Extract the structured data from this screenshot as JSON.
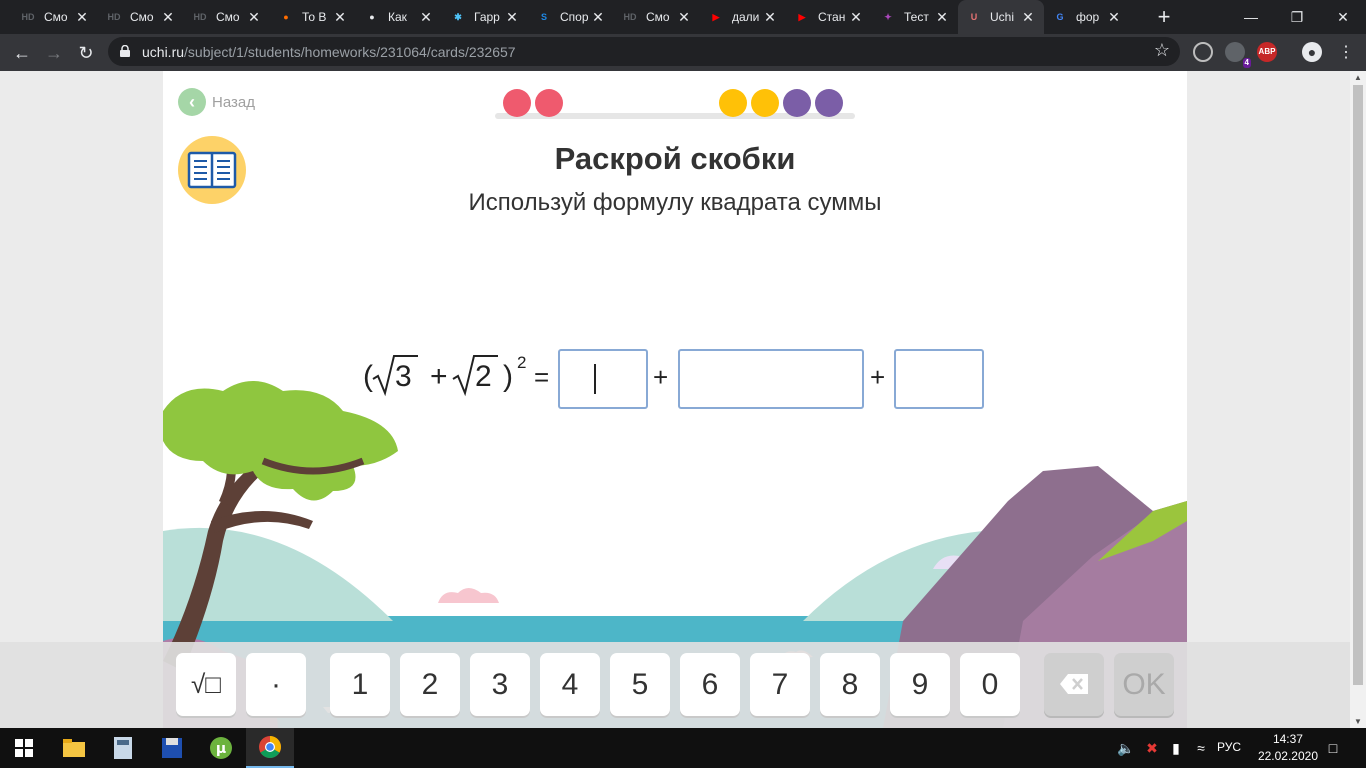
{
  "browser": {
    "tabs": [
      {
        "title": "Смо",
        "icon": "hd-icon",
        "icon_text": "HD",
        "icon_color": "#5f6368"
      },
      {
        "title": "Смо",
        "icon": "hd-icon",
        "icon_text": "HD",
        "icon_color": "#5f6368"
      },
      {
        "title": "Смо",
        "icon": "hd-icon",
        "icon_text": "HD",
        "icon_color": "#5f6368"
      },
      {
        "title": "То В",
        "icon": "flame-icon",
        "icon_text": "●",
        "icon_color": "#ff6d00"
      },
      {
        "title": "Как",
        "icon": "globe-icon",
        "icon_text": "●",
        "icon_color": "#e8eaed"
      },
      {
        "title": "Гарр",
        "icon": "sparkle-icon",
        "icon_text": "✱",
        "icon_color": "#4fc3f7"
      },
      {
        "title": "Спор",
        "icon": "s-icon",
        "icon_text": "S",
        "icon_color": "#1e88e5"
      },
      {
        "title": "Смо",
        "icon": "hd-icon",
        "icon_text": "HD",
        "icon_color": "#5f6368"
      },
      {
        "title": "дали",
        "icon": "youtube-icon",
        "icon_text": "▶",
        "icon_color": "#ff0000"
      },
      {
        "title": "Стан",
        "icon": "youtube-icon",
        "icon_text": "▶",
        "icon_color": "#ff0000"
      },
      {
        "title": "Тест",
        "icon": "wand-icon",
        "icon_text": "✦",
        "icon_color": "#ab47bc"
      },
      {
        "title": "Uchi",
        "icon": "uchi-icon",
        "icon_text": "U",
        "icon_color": "#e57373",
        "active": true
      },
      {
        "title": "фор",
        "icon": "google-icon",
        "icon_text": "G",
        "icon_color": "#4285f4"
      }
    ],
    "url_host": "uchi.ru",
    "url_path": "/subject/1/students/homeworks/231064/cards/232657",
    "extension_badge": "4",
    "adblock_label": "ABP"
  },
  "page": {
    "back_label": "Назад",
    "progress": [
      {
        "color": "#ef5a6e",
        "state": "wrong"
      },
      {
        "color": "#ef5a6e",
        "state": "wrong"
      },
      {
        "color": "#ffc107",
        "state": "correct"
      },
      {
        "color": "#ffc107",
        "state": "correct"
      },
      {
        "color": "#7b5ea7",
        "state": "pending"
      },
      {
        "color": "#7b5ea7",
        "state": "pending"
      }
    ],
    "title": "Раскрой скобки",
    "subtitle": "Используй формулу квадрата суммы",
    "equation": {
      "open_paren": "(",
      "radicand_1": "3",
      "plus": "+",
      "radicand_2": "2",
      "close_paren": ")",
      "exponent": "2",
      "equals": "=",
      "answer_values": [
        "",
        "",
        ""
      ]
    }
  },
  "keypad": {
    "keys": [
      "√□",
      "·",
      "1",
      "2",
      "3",
      "4",
      "5",
      "6",
      "7",
      "8",
      "9",
      "0"
    ],
    "backspace_label": "⌫",
    "ok_label": "OK"
  },
  "taskbar": {
    "apps": [
      "windows-start",
      "file-explorer",
      "calculator",
      "save-app",
      "utorrent",
      "chrome"
    ],
    "language": "РУС",
    "time": "14:37",
    "date": "22.02.2020"
  }
}
